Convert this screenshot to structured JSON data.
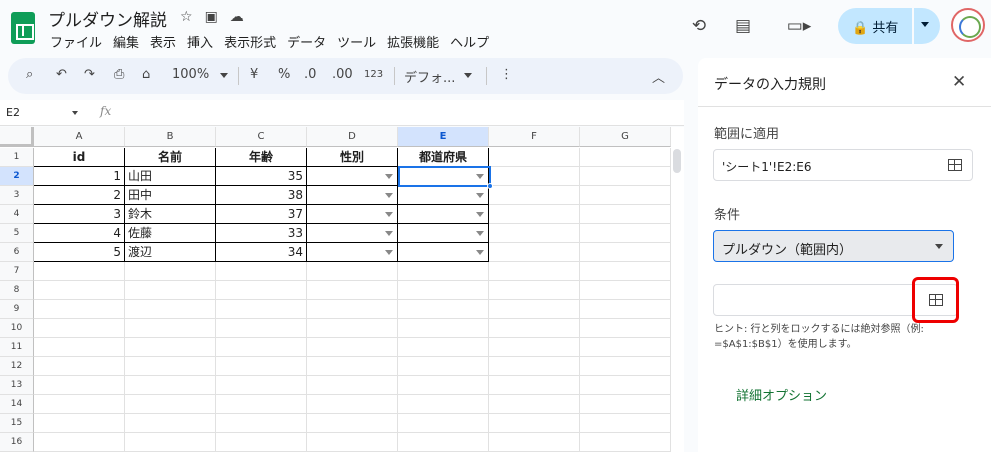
{
  "title_bar": {
    "doc_title": "プルダウン解説",
    "menu": [
      "ファイル",
      "編集",
      "表示",
      "挿入",
      "表示形式",
      "データ",
      "ツール",
      "拡張機能",
      "ヘルプ"
    ],
    "share_label": "共有"
  },
  "toolbar": {
    "zoom": "100%",
    "currency": "¥",
    "percent": "%",
    "dec_decrease": ".0",
    "dec_increase": ".00",
    "number_format": "123",
    "font": "デフォ..."
  },
  "formula_bar": {
    "name_box": "E2",
    "fx_label": "fx"
  },
  "grid": {
    "columns": [
      "A",
      "B",
      "C",
      "D",
      "E",
      "F",
      "G"
    ],
    "row_numbers": [
      "1",
      "2",
      "3",
      "4",
      "5",
      "6",
      "7",
      "8",
      "9",
      "10",
      "11",
      "12",
      "13",
      "14",
      "15",
      "16"
    ],
    "headers": [
      "id",
      "名前",
      "年齢",
      "性別",
      "都道府県"
    ],
    "rows": [
      {
        "id": "1",
        "name": "山田",
        "age": "35"
      },
      {
        "id": "2",
        "name": "田中",
        "age": "38"
      },
      {
        "id": "3",
        "name": "鈴木",
        "age": "37"
      },
      {
        "id": "4",
        "name": "佐藤",
        "age": "33"
      },
      {
        "id": "5",
        "name": "渡辺",
        "age": "34"
      }
    ]
  },
  "panel": {
    "title": "データの入力規則",
    "range_label": "範囲に適用",
    "range_value": "'シート1'!E2:E6",
    "condition_label": "条件",
    "condition_value": "プルダウン（範囲内）",
    "hint": "ヒント: 行と列をロックするには絶対参照（例: =$A$1:$B$1）を使用します。",
    "advanced": "詳細オプション"
  }
}
